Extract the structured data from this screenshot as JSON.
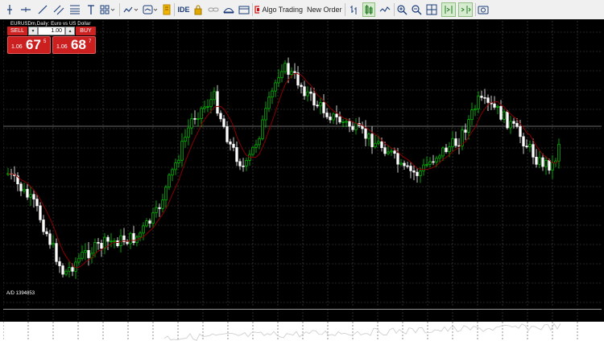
{
  "toolbar": {
    "ide_label": "IDE",
    "algo_trading_label": "Algo Trading",
    "new_order_label": "New Order"
  },
  "chart": {
    "symbol_label": "EURUSDm,Daily: Euro vs US Dollar",
    "indicator_label": "A/D 1394853",
    "colors": {
      "background": "#000000",
      "grid": "#4a4a4a",
      "bull_candle": "#00d000",
      "bear_candle": "#ffffff",
      "moving_average": "#8b0000",
      "indicator_line": "#cfcfcf"
    }
  },
  "trade_panel": {
    "sell_label": "SELL",
    "buy_label": "BUY",
    "lot_value": "1.00",
    "lot_minus": "▾",
    "lot_plus": "▴",
    "sell_price_prefix": "1.06",
    "sell_price_big": "67",
    "sell_price_sup": "5",
    "buy_price_prefix": "1.06",
    "buy_price_big": "68",
    "buy_price_sup": "7"
  }
}
